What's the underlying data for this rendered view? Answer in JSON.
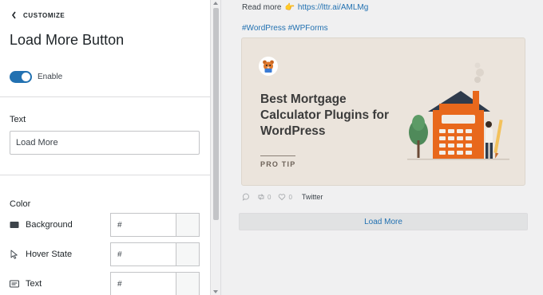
{
  "panel": {
    "back_label": "CUSTOMIZE",
    "title": "Load More Button",
    "enable_label": "Enable",
    "enabled": true,
    "text_section_label": "Text",
    "text_value": "Load More",
    "color_section_label": "Color",
    "color_rows": [
      {
        "label": "Background",
        "value": "#",
        "icon": "background-swatch-icon"
      },
      {
        "label": "Hover State",
        "value": "#",
        "icon": "cursor-pointer-icon"
      },
      {
        "label": "Text",
        "value": "#",
        "icon": "text-color-icon"
      }
    ]
  },
  "preview": {
    "read_more_text": "Read more",
    "read_more_emoji": "👉",
    "read_more_link": "https://lttr.ai/AMLMg",
    "hashtags": "#WordPress #WPForms",
    "card": {
      "title": "Best Mortgage Calculator Plugins for WordPress",
      "tag": "PRO TIP",
      "logo_icon": "wpforms-bear-logo-icon",
      "illustration": "house-calculator-illustration"
    },
    "social": {
      "retweet_count": "0",
      "like_count": "0",
      "network": "Twitter"
    },
    "load_more_label": "Load More"
  },
  "colors": {
    "accent": "#2271b1",
    "card_bg": "#ebe4dc",
    "house": "#e8681c"
  }
}
